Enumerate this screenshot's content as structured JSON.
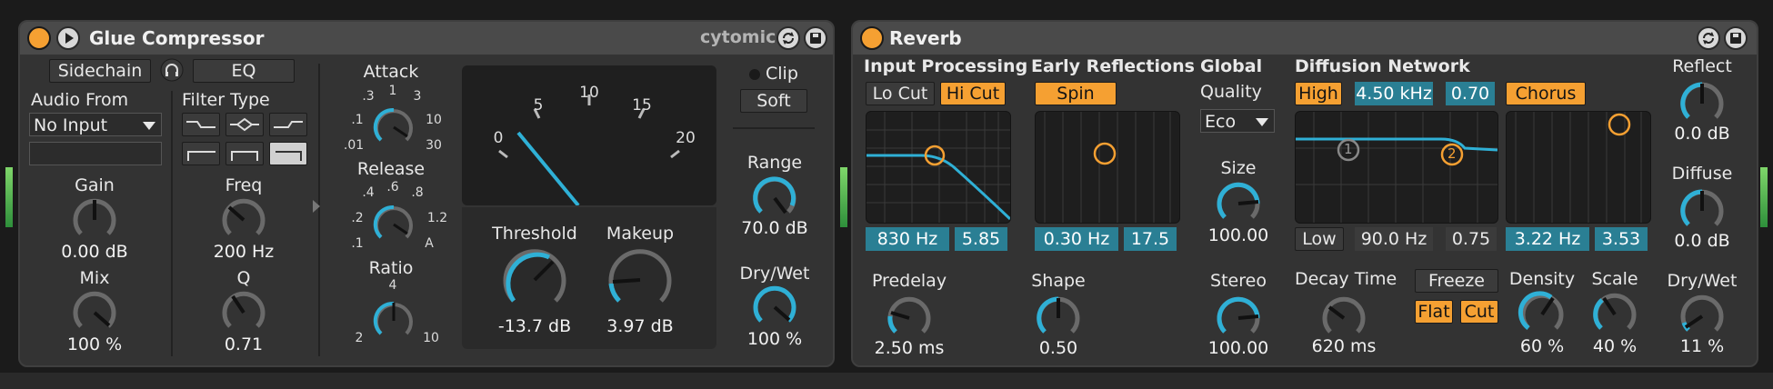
{
  "glue": {
    "title": "Glue Compressor",
    "brand": "cytomic",
    "sidechain_label": "Sidechain",
    "eq_label": "EQ",
    "audio_from_label": "Audio From",
    "audio_from_value": "No Input",
    "filter_type_label": "Filter Type",
    "gain": {
      "label": "Gain",
      "value": "0.00 dB"
    },
    "mix": {
      "label": "Mix",
      "value": "100 %"
    },
    "freq": {
      "label": "Freq",
      "value": "200 Hz"
    },
    "q": {
      "label": "Q",
      "value": "0.71"
    },
    "attack": {
      "label": "Attack",
      "scale": [
        ".3",
        "1",
        "3",
        ".1",
        "10",
        ".01",
        "30"
      ]
    },
    "release": {
      "label": "Release",
      "scale": [
        ".4",
        ".6",
        ".8",
        ".2",
        "1.2",
        ".1",
        "A"
      ]
    },
    "ratio": {
      "label": "Ratio",
      "scale": [
        "4",
        "2",
        "10"
      ]
    },
    "meter_scale": [
      "0",
      "5",
      "10",
      "15",
      "20"
    ],
    "threshold": {
      "label": "Threshold",
      "value": "-13.7 dB"
    },
    "makeup": {
      "label": "Makeup",
      "value": "3.97 dB"
    },
    "clip_label": "Clip",
    "soft_label": "Soft",
    "range": {
      "label": "Range",
      "value": "70.0 dB"
    },
    "drywet": {
      "label": "Dry/Wet",
      "value": "100 %"
    }
  },
  "reverb": {
    "title": "Reverb",
    "input_processing_label": "Input Processing",
    "lo_cut_label": "Lo Cut",
    "hi_cut_label": "Hi Cut",
    "input_freq": "830 Hz",
    "input_q": "5.85",
    "predelay": {
      "label": "Predelay",
      "value": "2.50 ms"
    },
    "early_reflections_label": "Early Reflections",
    "spin_label": "Spin",
    "er_freq": "0.30 Hz",
    "er_amount": "17.5",
    "shape": {
      "label": "Shape",
      "value": "0.50"
    },
    "global_label": "Global",
    "quality_label": "Quality",
    "quality_value": "Eco",
    "size": {
      "label": "Size",
      "value": "100.00"
    },
    "stereo": {
      "label": "Stereo",
      "value": "100.00"
    },
    "diffusion_network_label": "Diffusion Network",
    "high_label": "High",
    "high_freq": "4.50 kHz",
    "high_val": "0.70",
    "low_label": "Low",
    "low_freq": "90.0 Hz",
    "low_val": "0.75",
    "chorus_label": "Chorus",
    "chorus_freq": "3.22 Hz",
    "chorus_amount": "3.53",
    "decay": {
      "label": "Decay Time",
      "value": "620 ms"
    },
    "freeze_label": "Freeze",
    "flat_label": "Flat",
    "cut_label": "Cut",
    "density": {
      "label": "Density",
      "value": "60 %"
    },
    "scale": {
      "label": "Scale",
      "value": "40 %"
    },
    "reflect": {
      "label": "Reflect",
      "value": "0.0 dB"
    },
    "diffuse": {
      "label": "Diffuse",
      "value": "0.0 dB"
    },
    "drywet": {
      "label": "Dry/Wet",
      "value": "11 %"
    },
    "node1": "1",
    "node2": "2"
  },
  "colors": {
    "accent": "#f5a032",
    "knob_blue": "#2fb0d6",
    "field_blue": "#2a7f94",
    "panel": "#333333"
  },
  "icons": [
    "play-icon",
    "headphones-icon",
    "refresh-icon",
    "save-icon",
    "dropdown-arrow-icon",
    "filter-shape-icon"
  ]
}
